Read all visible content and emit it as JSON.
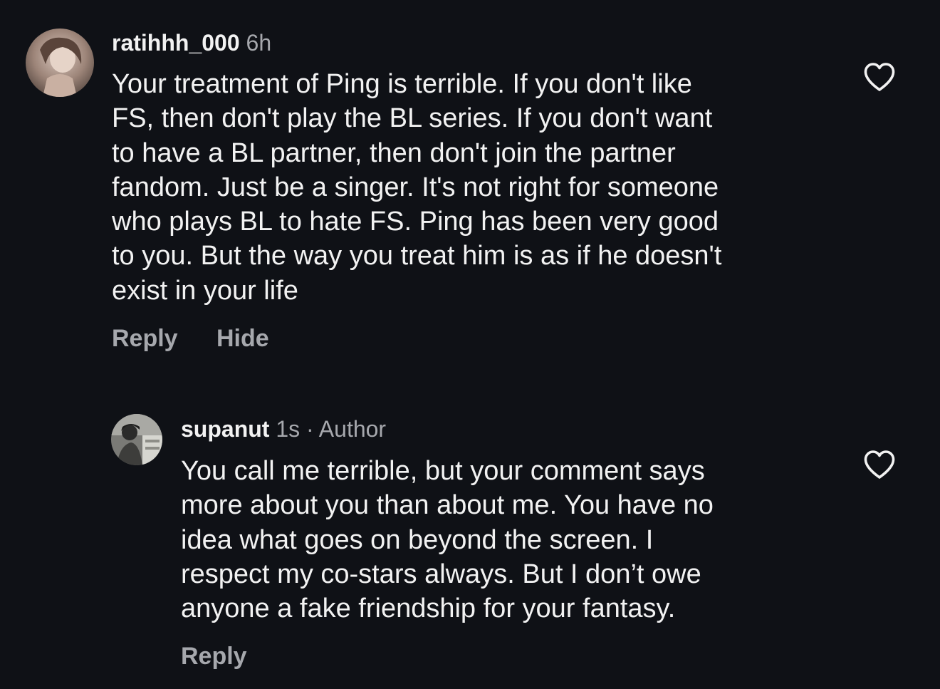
{
  "comments": [
    {
      "username": "ratihhh_000",
      "time": "6h",
      "body_lines": [
        "Your treatment of Ping is terrible. If you don't like",
        "FS, then don't play the BL series. If you don't want",
        "to have a BL partner, then don't join the partner",
        "fandom. Just be a singer. It's not right for someone",
        "who plays BL to hate FS. Ping has been very good",
        "to you. But the way you treat him is as if he doesn't",
        "exist in your life"
      ],
      "reply_label": "Reply",
      "hide_label": "Hide",
      "like_icon": "heart-outline-icon"
    },
    {
      "username": "supanut",
      "time": "1s",
      "separator": "·",
      "author_tag": "Author",
      "body_lines": [
        "You call me terrible, but your comment says",
        "more about you than about me. You have no",
        "idea what goes on beyond the screen. I",
        "respect my co-stars always. But I don’t owe",
        "anyone a fake friendship for your fantasy."
      ],
      "reply_label": "Reply",
      "like_icon": "heart-outline-icon"
    }
  ],
  "colors": {
    "background": "#0f1116",
    "primary_text": "#f2f2f2",
    "secondary_text": "#a6a8ad"
  }
}
